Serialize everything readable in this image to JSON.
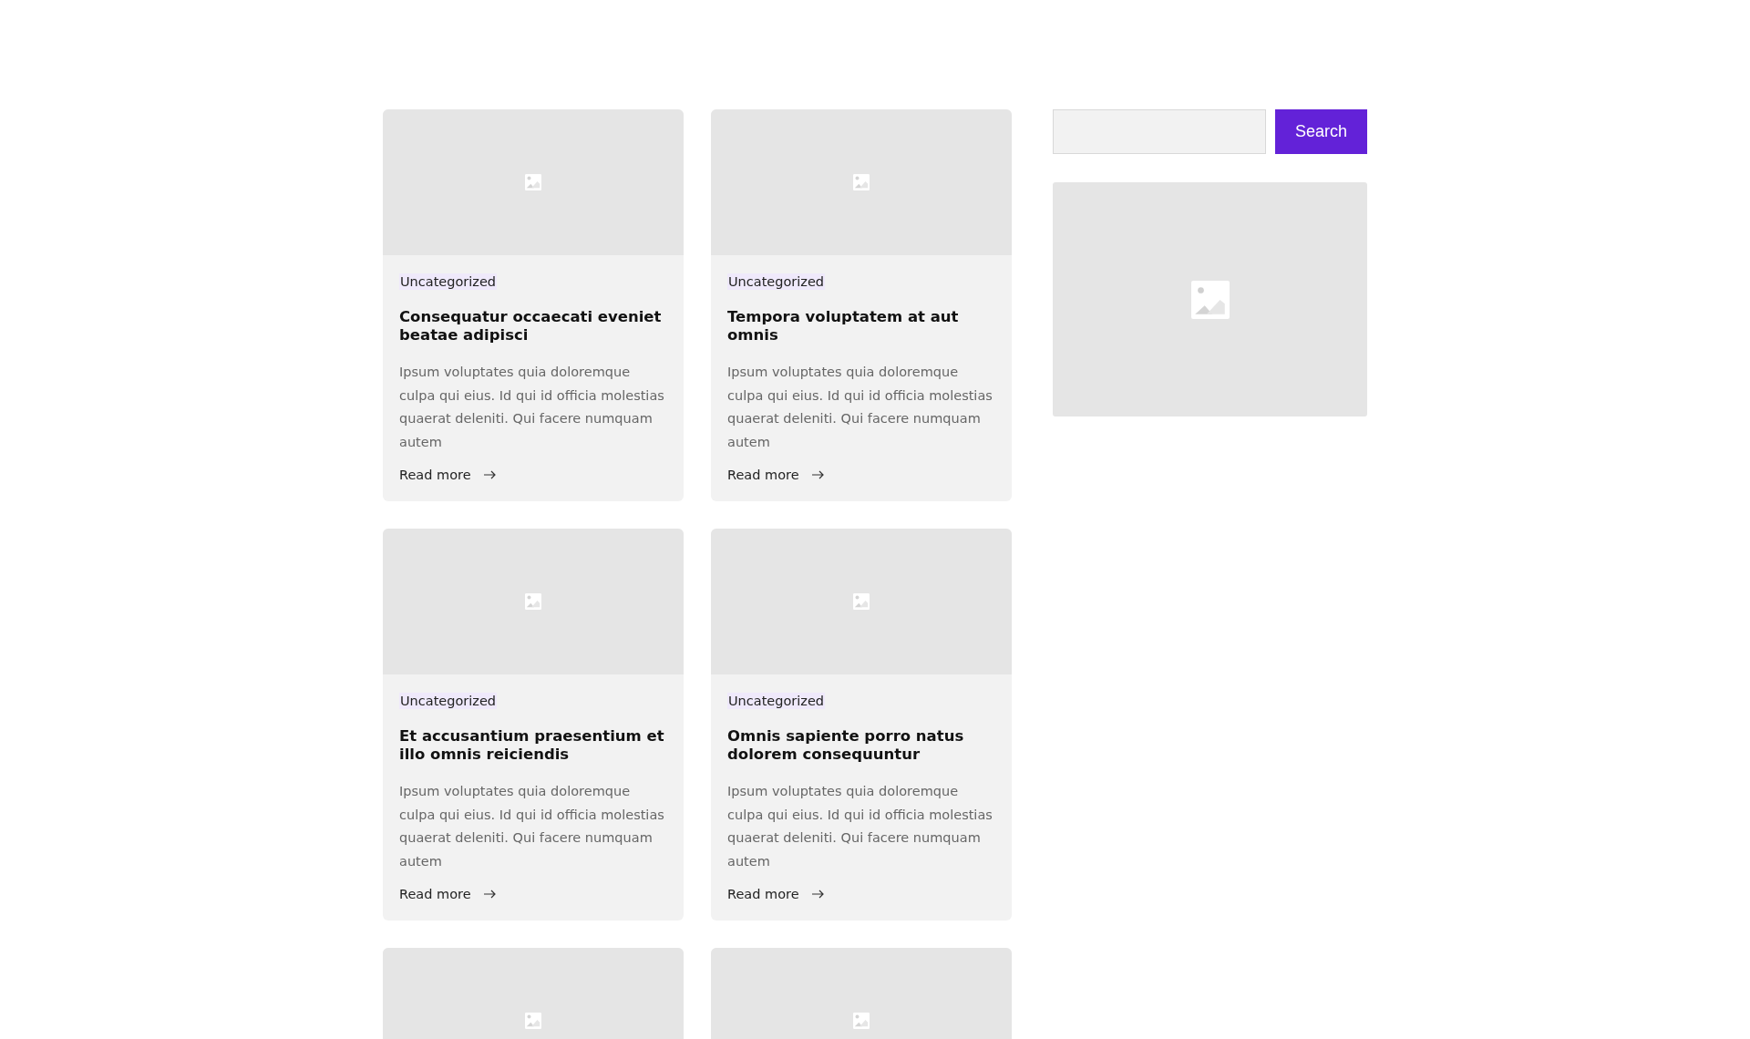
{
  "posts": [
    {
      "kind": "full",
      "category": "Uncategorized",
      "title": "Consequatur occaecati eveniet beatae adipisci",
      "excerpt": "Ipsum voluptates quia doloremque culpa qui eius. Id qui id officia molestias quaerat deleniti. Qui facere numquam autem",
      "link": "Read more"
    },
    {
      "kind": "full",
      "category": "Uncategorized",
      "title": "Tempora voluptatem at aut omnis",
      "excerpt": "Ipsum voluptates quia doloremque culpa qui eius. Id qui id officia molestias quaerat deleniti. Qui facere numquam autem",
      "link": "Read more"
    },
    {
      "kind": "full",
      "category": "Uncategorized",
      "title": "Et accusantium praesentium et illo omnis reiciendis",
      "excerpt": "Ipsum voluptates quia doloremque culpa qui eius. Id qui id officia molestias quaerat deleniti. Qui facere numquam autem",
      "link": "Read more"
    },
    {
      "kind": "full",
      "category": "Uncategorized",
      "title": "Omnis sapiente porro natus dolorem consequuntur",
      "excerpt": "Ipsum voluptates quia doloremque culpa qui eius. Id qui id officia molestias quaerat deleniti. Qui facere numquam autem",
      "link": "Read more"
    },
    {
      "kind": "image_only"
    },
    {
      "kind": "image_only"
    }
  ],
  "sidebar": {
    "search": {
      "button": "Search"
    }
  }
}
